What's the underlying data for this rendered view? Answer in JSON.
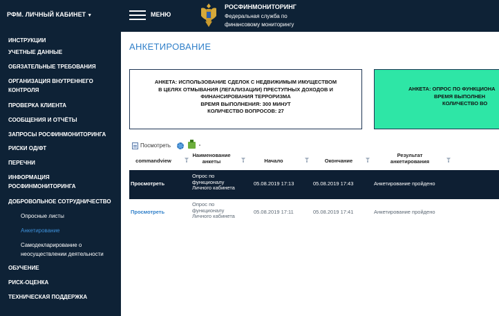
{
  "header": {
    "cabinet_title": "РФМ. ЛИЧНЫЙ КАБИНЕТ",
    "menu_label": "МЕНЮ",
    "brand_name": "РОСФИНМОНИТОРИНГ",
    "brand_sub_1": "Федеральная служба по",
    "brand_sub_2": "финансовому мониторингу"
  },
  "sidebar": {
    "items": [
      {
        "label": "ИНСТРУКЦИИ"
      },
      {
        "label": "УЧЕТНЫЕ ДАННЫЕ"
      },
      {
        "label": "ОБЯЗАТЕЛЬНЫЕ ТРЕБОВАНИЯ"
      },
      {
        "label": "ОРГАНИЗАЦИЯ ВНУТРЕННЕГО КОНТРОЛЯ"
      },
      {
        "label": "ПРОВЕРКА КЛИЕНТА"
      },
      {
        "label": "СООБЩЕНИЯ И ОТЧЁТЫ"
      },
      {
        "label": "ЗАПРОСЫ РОСФИНМОНИТОРИНГА"
      },
      {
        "label": "РИСКИ ОД/ФТ"
      },
      {
        "label": "ПЕРЕЧНИ"
      },
      {
        "label": "ИНФОРМАЦИЯ РОСФИНМОНИТОРИНГА"
      },
      {
        "label": "ДОБРОВОЛЬНОЕ СОТРУДНИЧЕСТВО"
      },
      {
        "label": "ОБУЧЕНИЕ"
      },
      {
        "label": "РИСК-ОЦЕНКА"
      },
      {
        "label": "ТЕХНИЧЕСКАЯ ПОДДЕРЖКА"
      }
    ],
    "subitems": [
      {
        "label": "Опросные листы"
      },
      {
        "label": "Анкетирование"
      },
      {
        "label": "Самодекларирование о неосуществлении деятельности"
      }
    ]
  },
  "main": {
    "page_title": "АНКЕТИРОВАНИЕ",
    "cards": [
      {
        "lines": [
          "АНКЕТА: ИСПОЛЬЗОВАНИЕ СДЕЛОК С НЕДВИЖИМЫМ ИМУЩЕСТВОМ",
          "В ЦЕЛЯХ ОТМЫВАНИЯ (ЛЕГАЛИЗАЦИИ) ПРЕСТУПНЫХ ДОХОДОВ И",
          "ФИНАНСИРОВАНИЯ ТЕРРОРИЗМА",
          "ВРЕМЯ ВЫПОЛНЕНИЯ: 300 МИНУТ",
          "КОЛИЧЕСТВО ВОПРОСОВ: 27"
        ]
      },
      {
        "lines": [
          "АНКЕТА: ОПРОС ПО ФУНКЦИОНА",
          "ВРЕМЯ ВЫПОЛНЕН",
          "КОЛИЧЕСТВО ВО"
        ]
      }
    ],
    "toolbar": {
      "view_label": "Посмотреть"
    },
    "table": {
      "columns": [
        "commandview",
        "Наименование анкеты",
        "Начало",
        "Окончание",
        "Результат анкетирования"
      ],
      "rows": [
        {
          "action": "Просмотреть",
          "name": "Опрос по функционалу Личного кабинета",
          "start": "05.08.2019 17:13",
          "end": "05.08.2019 17:43",
          "result": "Анкетирование пройдено"
        },
        {
          "action": "Просмотреть",
          "name": "Опрос по функционалу Личного кабинета",
          "start": "05.08.2019 17:11",
          "end": "05.08.2019 17:41",
          "result": "Анкетирование пройдено"
        }
      ]
    }
  },
  "colors": {
    "sidebar_bg": "#0e2236",
    "accent": "#2f7fc9",
    "card_green": "#2ee6a6",
    "selected_row": "#0e1f33"
  }
}
